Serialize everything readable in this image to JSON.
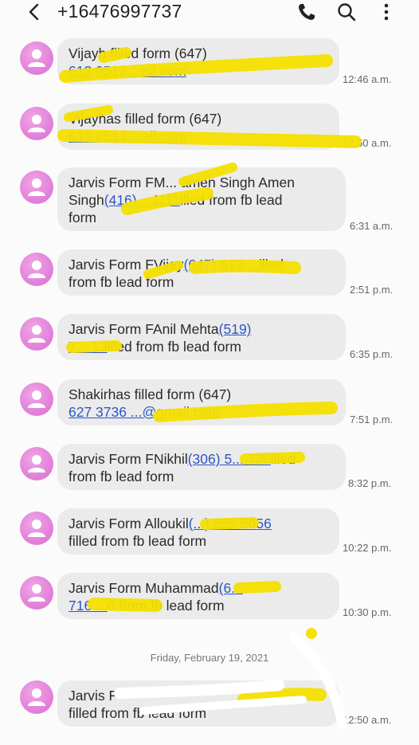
{
  "header": {
    "title": "+16476997737",
    "back_icon": "chevron-left-icon",
    "call_icon": "phone-icon",
    "search_icon": "search-icon",
    "menu_icon": "more-vertical-icon"
  },
  "accent": {
    "avatar": "#e07dd8",
    "link": "#2d57c7",
    "bubble": "#ebebeb",
    "highlighter": "#f5e000"
  },
  "date_separator": "Friday, February 19, 2021",
  "messages": [
    {
      "l1_pre": "Vijayh",
      "l1_post": "filled form (647)",
      "l2_link": "613 0513 ...ail.com",
      "time": "12:46 a.m."
    },
    {
      "l1_pre": "Vijayhas filled form (647)",
      "l2_link": "613 0513 ...ail.com",
      "time": "12:50 a.m."
    },
    {
      "l1": "Jarvis Form FM... amen Singh Amen",
      "l2_pre": "Singh",
      "l2_link": "(416) ...1111",
      "l2_post": "illed from fb lead",
      "l3": "form",
      "time": "6:31 a.m."
    },
    {
      "l1_pre": "Jarvis Form FVijay",
      "l1_link": "(647) 613 ...",
      "l1_post": "illed",
      "l2": "from fb lead form",
      "time": "2:51 p.m."
    },
    {
      "l1_pre": "Jarvis Form FAnil Mehta",
      "l1_link": "(519)",
      "l2_link": "7... 13",
      "l2_post": "illed from fb lead form",
      "time": "6:35 p.m."
    },
    {
      "l1": "Shakirhas filled form (647)",
      "l2_link": "627 3736 ...@gmail.com",
      "time": "7:51 p.m."
    },
    {
      "l1_pre": "Jarvis Form FNikhil",
      "l1_link": "(306) 5... 726",
      "l1_post": "illed",
      "l2": "from fb lead form",
      "time": "8:32 p.m."
    },
    {
      "l1_pre": "Jarvis Form Alloukil",
      "l1_link": "(...) 555 5656",
      "l2": "filled from fb lead form",
      "time": "10:22 p.m."
    },
    {
      "l1_pre": "Jarvis Form Muhammad",
      "l1_link": "(6...",
      "l2_link": "716 ...",
      "l2_post": "d from fb lead form",
      "time": "10:30 p.m."
    },
    {
      "l1": "Jarvis F",
      "l2": "filled from fb lead form",
      "time": "12:50 a.m."
    }
  ]
}
